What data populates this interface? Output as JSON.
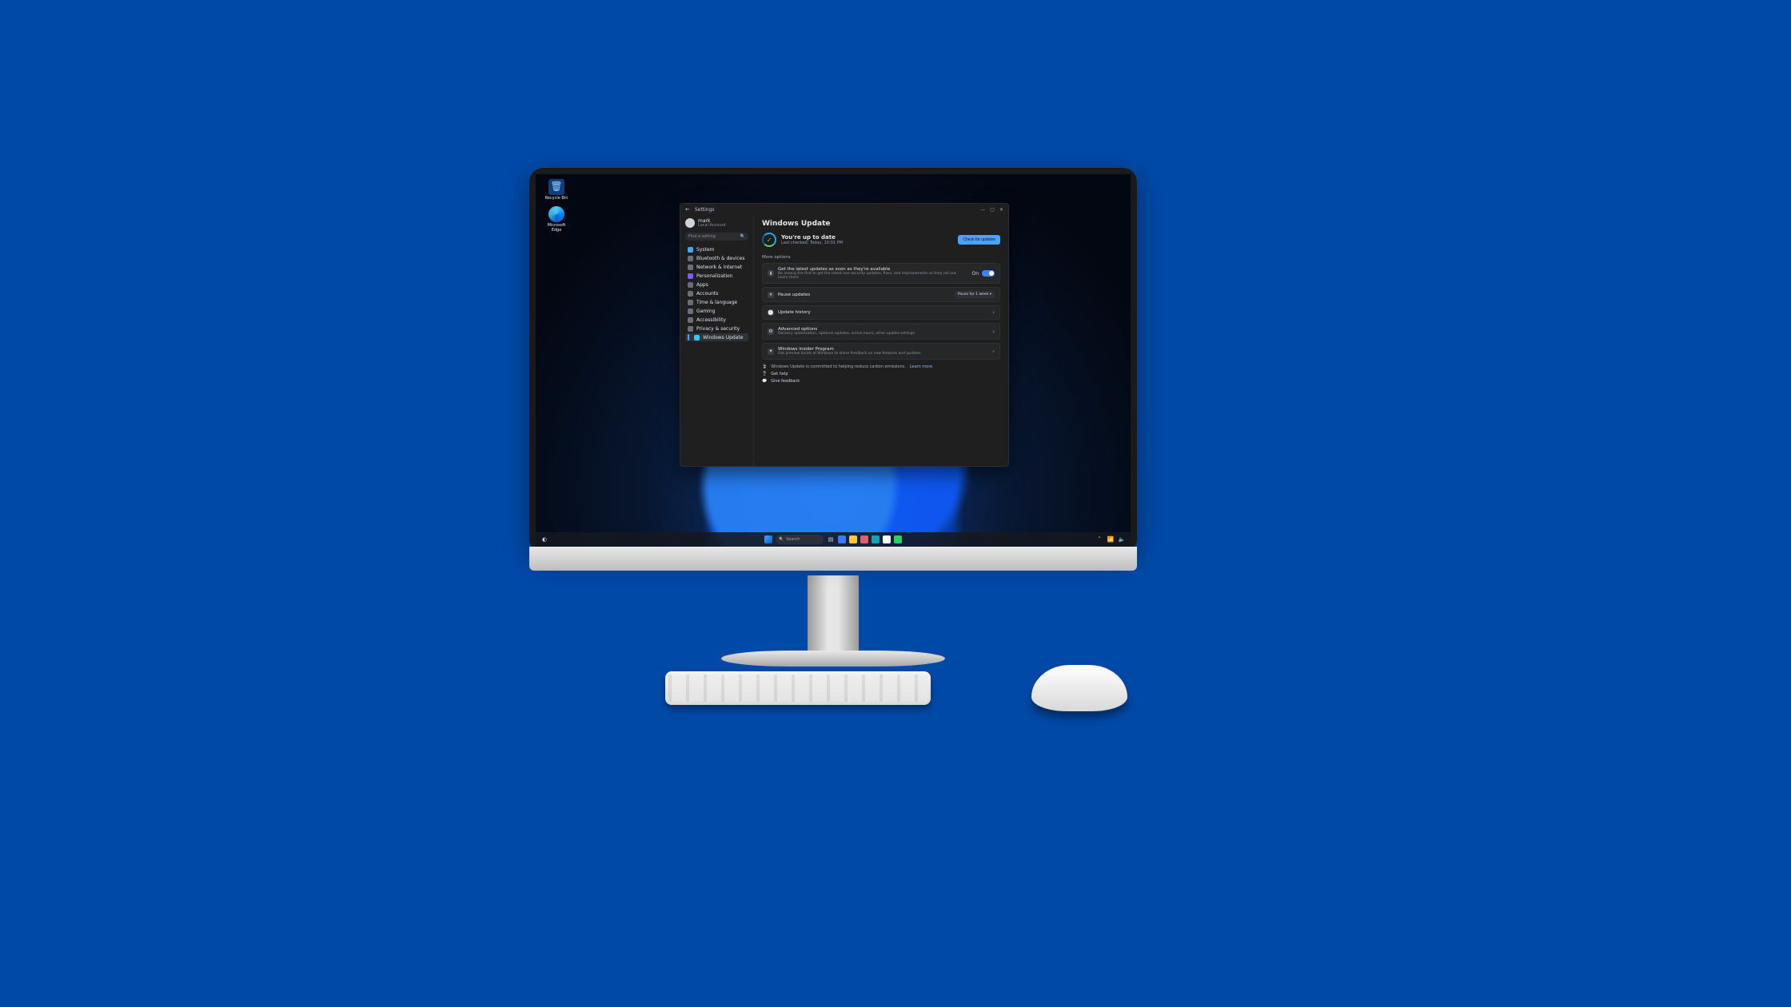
{
  "desktop": {
    "recycle_label": "Recycle Bin",
    "edge_label": "Microsoft Edge"
  },
  "taskbar": {
    "search_placeholder": "Search"
  },
  "settings": {
    "app_title": "Settings",
    "profile": {
      "name": "mark",
      "account_type": "Local Account"
    },
    "search_placeholder": "Find a setting",
    "sidebar": {
      "items": [
        {
          "label": "System"
        },
        {
          "label": "Bluetooth & devices"
        },
        {
          "label": "Network & internet"
        },
        {
          "label": "Personalization"
        },
        {
          "label": "Apps"
        },
        {
          "label": "Accounts"
        },
        {
          "label": "Time & language"
        },
        {
          "label": "Gaming"
        },
        {
          "label": "Accessibility"
        },
        {
          "label": "Privacy & security"
        },
        {
          "label": "Windows Update"
        }
      ]
    },
    "page": {
      "title": "Windows Update",
      "status_heading": "You're up to date",
      "status_sub": "Last checked: Today, 10:01 PM",
      "check_button": "Check for updates",
      "more_options": "More options",
      "cards": [
        {
          "title": "Get the latest updates as soon as they're available",
          "sub": "Be among the first to get the latest non-security updates, fixes, and improvements as they roll out. Learn more",
          "toggle_state": "On"
        },
        {
          "title": "Pause updates",
          "pill": "Pause for 1 week"
        },
        {
          "title": "Update history"
        },
        {
          "title": "Advanced options",
          "sub": "Delivery optimization, optional updates, active hours, other update settings"
        },
        {
          "title": "Windows Insider Program",
          "sub": "Get preview builds of Windows to share feedback on new features and updates"
        }
      ],
      "footer": {
        "carbon_msg": "Windows Update is committed to helping reduce carbon emissions.",
        "learn_more": "Learn more",
        "get_help": "Get help",
        "give_feedback": "Give feedback"
      }
    }
  }
}
